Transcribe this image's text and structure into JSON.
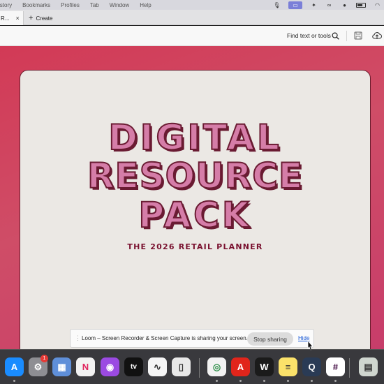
{
  "menubar": {
    "items": [
      "istory",
      "Bookmarks",
      "Profiles",
      "Tab",
      "Window",
      "Help"
    ]
  },
  "tabstrip": {
    "active_tab_label": "R...",
    "close_glyph": "×",
    "create_label": "Create",
    "create_glyph": "+"
  },
  "toolbar": {
    "find_label": "Find text or tools"
  },
  "document": {
    "title_lines": [
      "DIGITAL",
      "RESOURCE",
      "PACK"
    ],
    "subtitle": "THE 2026 RETAIL PLANNER"
  },
  "loom_banner": {
    "message": "Loom – Screen Recorder & Screen Capture is sharing your screen.",
    "stop_label": "Stop sharing",
    "hide_label": "Hide"
  },
  "dock": {
    "notification_badge": "1",
    "apps": [
      {
        "name": "App Store",
        "icon": "app-store-icon",
        "color": "#1a8cff",
        "glyph": "A"
      },
      {
        "name": "System Settings",
        "icon": "settings-icon",
        "color": "#8e8e93",
        "glyph": "⚙"
      },
      {
        "name": "Preview",
        "icon": "preview-icon",
        "color": "#5f8fd9",
        "glyph": "▦"
      },
      {
        "name": "News",
        "icon": "news-icon",
        "color": "#f2f2f2",
        "glyph": "N"
      },
      {
        "name": "Podcasts",
        "icon": "podcasts-icon",
        "color": "#9b4ae2",
        "glyph": "◉"
      },
      {
        "name": "TV",
        "icon": "tv-icon",
        "color": "#111111",
        "glyph": "tv"
      },
      {
        "name": "Freeform",
        "icon": "freeform-icon",
        "color": "#f5f5f5",
        "glyph": "∿"
      },
      {
        "name": "iPhone Mirroring",
        "icon": "iphone-mirroring-icon",
        "color": "#e8e8e8",
        "glyph": "▯"
      },
      {
        "name": "Chrome",
        "icon": "chrome-icon",
        "color": "#f2f2f2",
        "glyph": "◎"
      },
      {
        "name": "Acrobat",
        "icon": "acrobat-icon",
        "color": "#e1251b",
        "glyph": "A"
      },
      {
        "name": "Webex",
        "icon": "webex-icon",
        "color": "#1b1b1b",
        "glyph": "W"
      },
      {
        "name": "Notes",
        "icon": "notes-icon",
        "color": "#fbe26a",
        "glyph": "≡"
      },
      {
        "name": "QuickTime",
        "icon": "quicktime-icon",
        "color": "#2a3b55",
        "glyph": "Q"
      },
      {
        "name": "Slack",
        "icon": "slack-icon",
        "color": "#ffffff",
        "glyph": "#"
      },
      {
        "name": "Downloads",
        "icon": "downloads-stack-icon",
        "color": "#cfd6cf",
        "glyph": "▤"
      }
    ]
  }
}
